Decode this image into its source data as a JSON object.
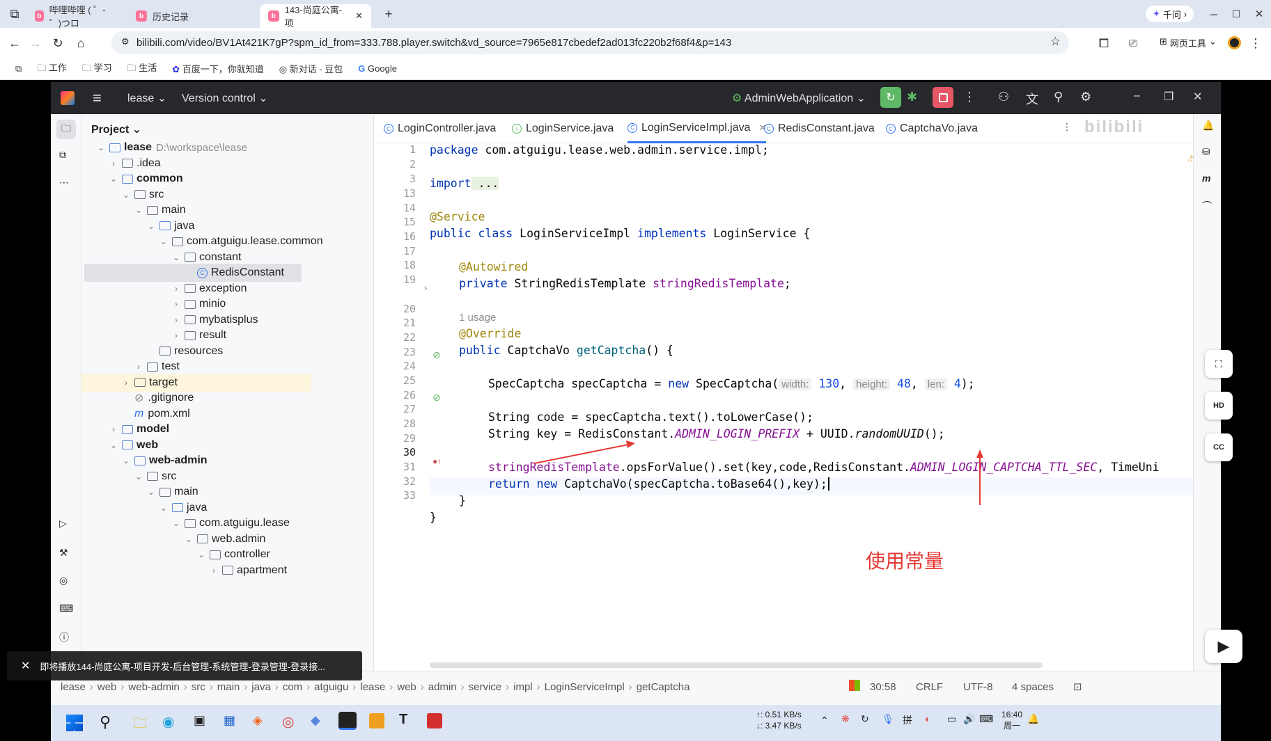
{
  "browser": {
    "tabs": [
      {
        "title": "哔哩哔哩 ( ゜- ゜)つロ"
      },
      {
        "title": "历史记录"
      },
      {
        "title": "143-尚庭公寓-项"
      }
    ],
    "qianwen_label": "千问",
    "url": "bilibili.com/video/BV1At421K7gP?spm_id_from=333.788.player.switch&vd_source=7965e817cbedef2ad013fc220b2f68f4&p=143",
    "web_tools_label": "网页工具",
    "bookmarks": [
      "工作",
      "学习",
      "生活",
      "百度一下，你就知道",
      "新对话 - 豆包",
      "Google"
    ]
  },
  "ide": {
    "project_name": "lease",
    "vcs_label": "Version control",
    "run_config": "AdminWebApplication",
    "project_panel_title": "Project",
    "tree": [
      {
        "label": "lease",
        "extra": "D:\\workspace\\lease",
        "bold": true,
        "depth": 0,
        "chev": "v",
        "icon": "module"
      },
      {
        "label": ".idea",
        "depth": 1,
        "chev": ">",
        "icon": "folder"
      },
      {
        "label": "common",
        "depth": 1,
        "chev": "v",
        "icon": "module",
        "bold": true
      },
      {
        "label": "src",
        "depth": 2,
        "chev": "v",
        "icon": "folder"
      },
      {
        "label": "main",
        "depth": 3,
        "chev": "v",
        "icon": "folder"
      },
      {
        "label": "java",
        "depth": 4,
        "chev": "v",
        "icon": "source"
      },
      {
        "label": "com.atguigu.lease.common",
        "depth": 5,
        "chev": "v",
        "icon": "package"
      },
      {
        "label": "constant",
        "depth": 6,
        "chev": "v",
        "icon": "package"
      },
      {
        "label": "RedisConstant",
        "depth": 7,
        "chev": "",
        "icon": "class",
        "selected": true
      },
      {
        "label": "exception",
        "depth": 6,
        "chev": ">",
        "icon": "package"
      },
      {
        "label": "minio",
        "depth": 6,
        "chev": ">",
        "icon": "package"
      },
      {
        "label": "mybatisplus",
        "depth": 6,
        "chev": ">",
        "icon": "package"
      },
      {
        "label": "result",
        "depth": 6,
        "chev": ">",
        "icon": "package"
      },
      {
        "label": "resources",
        "depth": 4,
        "chev": "",
        "icon": "folder"
      },
      {
        "label": "test",
        "depth": 3,
        "chev": ">",
        "icon": "folder"
      },
      {
        "label": "target",
        "depth": 2,
        "chev": ">",
        "icon": "folder",
        "highlight": true
      },
      {
        "label": ".gitignore",
        "depth": 2,
        "chev": "",
        "icon": "file"
      },
      {
        "label": "pom.xml",
        "depth": 2,
        "chev": "",
        "icon": "maven"
      },
      {
        "label": "model",
        "depth": 1,
        "chev": ">",
        "icon": "module",
        "bold": true
      },
      {
        "label": "web",
        "depth": 1,
        "chev": "v",
        "icon": "module",
        "bold": true
      },
      {
        "label": "web-admin",
        "depth": 2,
        "chev": "v",
        "icon": "module",
        "bold": true
      },
      {
        "label": "src",
        "depth": 3,
        "chev": "v",
        "icon": "folder"
      },
      {
        "label": "main",
        "depth": 4,
        "chev": "v",
        "icon": "folder"
      },
      {
        "label": "java",
        "depth": 5,
        "chev": "v",
        "icon": "source"
      },
      {
        "label": "com.atguigu.lease",
        "depth": 6,
        "chev": "v",
        "icon": "package"
      },
      {
        "label": "web.admin",
        "depth": 7,
        "chev": "v",
        "icon": "package"
      },
      {
        "label": "controller",
        "depth": 8,
        "chev": "v",
        "icon": "package"
      },
      {
        "label": "apartment",
        "depth": 9,
        "chev": ">",
        "icon": "package"
      }
    ],
    "editor_tabs": [
      {
        "label": "LoginController.java"
      },
      {
        "label": "LoginService.java"
      },
      {
        "label": "LoginServiceImpl.java",
        "active": true
      },
      {
        "label": "RedisConstant.java"
      },
      {
        "label": "CaptchaVo.java"
      }
    ],
    "warning_count": "1",
    "line_numbers": [
      "1",
      "2",
      "3",
      "13",
      "14",
      "15",
      "16",
      "17",
      "18",
      "19",
      "",
      "20",
      "21",
      "22",
      "23",
      "24",
      "25",
      "26",
      "27",
      "28",
      "29",
      "30",
      "31",
      "32",
      "33"
    ],
    "code": {
      "l1": [
        "package",
        " com.atguigu.lease.web.admin.service.impl;"
      ],
      "l3": [
        "import",
        " ..."
      ],
      "l14": "@Service",
      "l15": [
        "public class",
        " LoginServiceImpl ",
        "implements",
        " LoginService {"
      ],
      "l17": "@Autowired",
      "l18": [
        "private",
        " StringRedisTemplate ",
        "stringRedisTemplate",
        ";"
      ],
      "usage": "1 usage",
      "l20": "@Override",
      "l21": [
        "public",
        " CaptchaVo ",
        "getCaptcha",
        "() {"
      ],
      "l23": [
        "SpecCaptcha specCaptcha = ",
        "new",
        " SpecCaptcha(",
        "width:",
        "130",
        ", ",
        "height:",
        "48",
        ", ",
        "len:",
        "4",
        ");"
      ],
      "l25": "String code = specCaptcha.text().toLowerCase();",
      "l26": [
        "String key = RedisConstant.",
        "ADMIN_LOGIN_PREFIX",
        " + UUID.",
        "randomUUID",
        "();"
      ],
      "l28": [
        "stringRedisTemplate",
        ".opsForValue().set(key,code,RedisConstant.",
        "ADMIN_LOGIN_CAPTCHA_TTL_SEC",
        ", TimeUni"
      ],
      "l30": [
        "return new",
        " CaptchaVo(specCaptcha.toBase64(),key);"
      ],
      "l31": "}",
      "l32": "}"
    },
    "breadcrumbs": [
      "lease",
      "web",
      "web-admin",
      "src",
      "main",
      "java",
      "com",
      "atguigu",
      "lease",
      "web",
      "admin",
      "service",
      "impl",
      "LoginServiceImpl",
      "getCaptcha"
    ],
    "status": {
      "position": "30:58",
      "line_sep": "CRLF",
      "encoding": "UTF-8",
      "indent": "4 spaces"
    }
  },
  "annotation": "使用常量",
  "toast": "即将播放144-尚庭公寓-项目开发-后台管理-系统管理-登录管理-登录接...",
  "taskbar": {
    "net_up": "↑: 0.51 KB/s",
    "net_down": "↓: 3.47 KB/s",
    "time": "16:40",
    "day": "周一"
  },
  "colors": {
    "accent": "#3574f0",
    "annotation": "#e53935",
    "ide_header": "#27282c"
  }
}
